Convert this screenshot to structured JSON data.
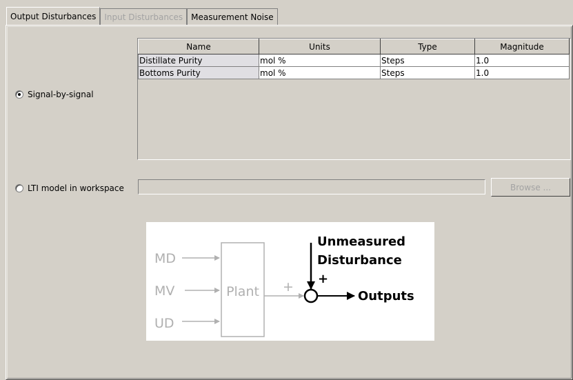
{
  "tabs": [
    {
      "label": "Output Disturbances",
      "state": "active"
    },
    {
      "label": "Input Disturbances",
      "state": "disabled"
    },
    {
      "label": "Measurement Noise",
      "state": "normal"
    }
  ],
  "signal_option": {
    "label": "Signal-by-signal",
    "selected": true
  },
  "lti_option": {
    "label": "LTI model in workspace",
    "selected": false
  },
  "table": {
    "columns": [
      "Name",
      "Units",
      "Type",
      "Magnitude"
    ],
    "rows": [
      {
        "name": "Distillate Purity",
        "units": "mol %",
        "type": "Steps",
        "magnitude": "1.0"
      },
      {
        "name": "Bottoms Purity",
        "units": "mol %",
        "type": "Steps",
        "magnitude": "1.0"
      }
    ]
  },
  "lti_field": {
    "value": ""
  },
  "browse_button": {
    "label": "Browse ...",
    "enabled": false
  },
  "diagram": {
    "inputs": [
      "MD",
      "MV",
      "UD"
    ],
    "plant_label": "Plant",
    "plus_left": "+",
    "plus_top": "+",
    "disturbance_line1": "Unmeasured",
    "disturbance_line2": "Disturbance",
    "outputs_label": "Outputs"
  }
}
